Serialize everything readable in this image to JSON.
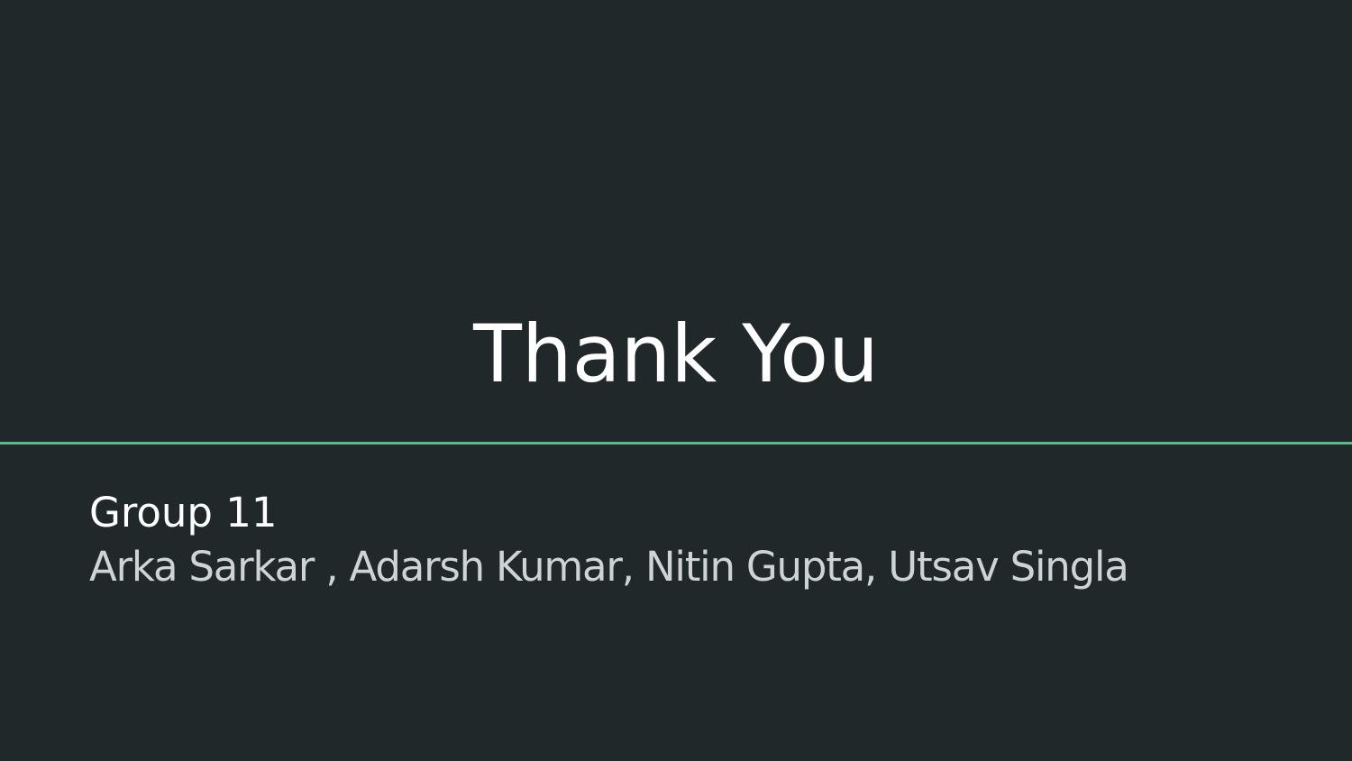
{
  "slide": {
    "title": "Thank You",
    "group": "Group 11",
    "members": "Arka Sarkar , Adarsh Kumar, Nitin Gupta, Utsav Singla"
  },
  "colors": {
    "background": "#21282a",
    "title_text": "#ffffff",
    "group_text": "#ffffff",
    "members_text": "#cfd3d4",
    "accent_line": "#57bb8a"
  }
}
